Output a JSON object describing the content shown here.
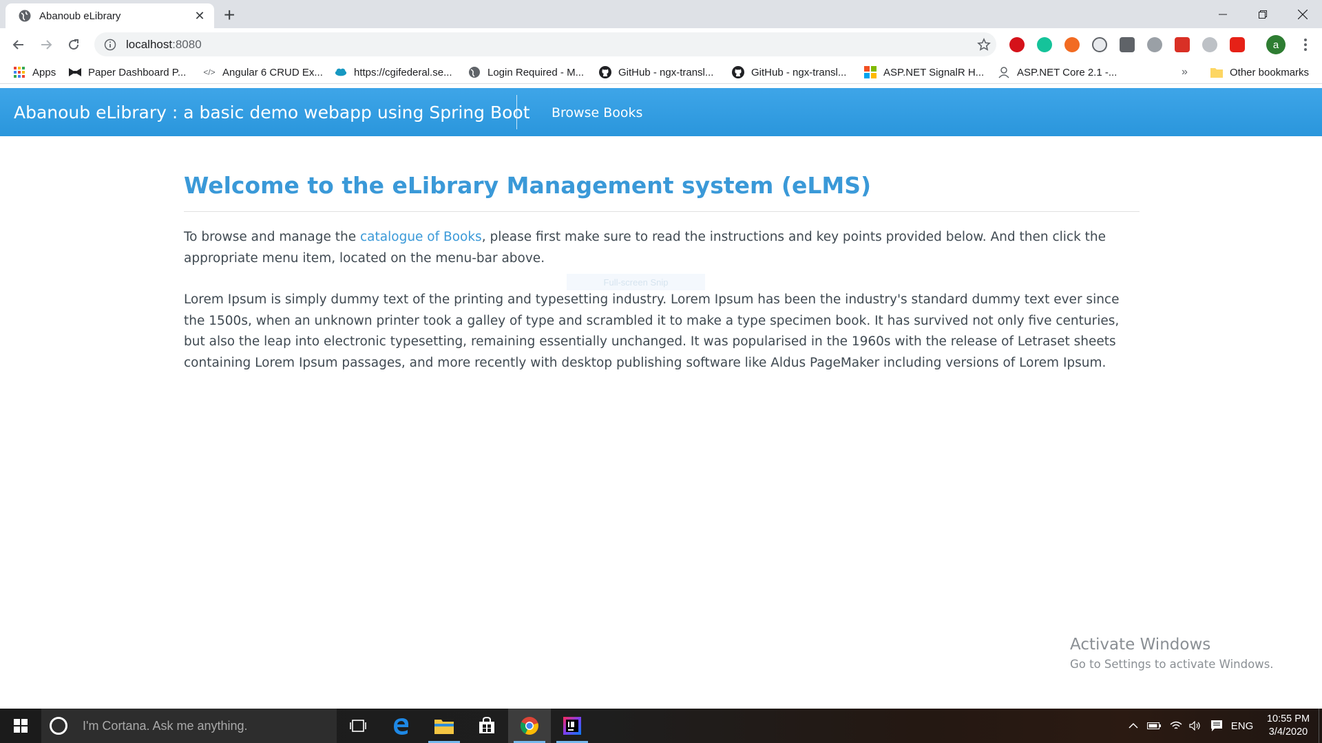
{
  "browser": {
    "tab_title": "Abanoub eLibrary",
    "new_tab": "+",
    "url_host": "localhost",
    "url_port": ":8080",
    "extension_icons": [
      "music-extension-icon",
      "grammarly-icon",
      "extension-orange-icon",
      "dark-mode-icon",
      "angular-devtools-icon",
      "extension-dots-icon",
      "extension-red-icon",
      "extension-cloud-icon",
      "youtube-extension-icon"
    ],
    "profile_initial": "a",
    "bookmarks": [
      {
        "label": "Apps",
        "icon": "apps-grid-icon"
      },
      {
        "label": "Paper Dashboard P...",
        "icon": "bowtie-icon"
      },
      {
        "label": "Angular 6 CRUD Ex...",
        "icon": "code-icon"
      },
      {
        "label": "https://cgifederal.se...",
        "icon": "salesforce-cloud-icon"
      },
      {
        "label": "Login Required - M...",
        "icon": "globe-icon"
      },
      {
        "label": "GitHub - ngx-transl...",
        "icon": "github-icon"
      },
      {
        "label": "GitHub - ngx-transl...",
        "icon": "github-icon"
      },
      {
        "label": "ASP.NET SignalR H...",
        "icon": "microsoft-icon"
      },
      {
        "label": "ASP.NET Core 2.1 -...",
        "icon": "avatar-icon"
      }
    ],
    "bookmarks_overflow": "»",
    "other_bookmarks": "Other bookmarks"
  },
  "app": {
    "brand": "Abanoub eLibrary : a basic demo webapp using Spring Boot",
    "nav_browse": "Browse Books"
  },
  "main": {
    "heading": "Welcome to the eLibrary Management system (eLMS)",
    "intro_before_link": "To browse and manage the ",
    "intro_link": "catalogue of Books",
    "intro_after_link": ", please first make sure to read the instructions and key points provided below. And then click the appropriate menu item, located on the menu-bar above.",
    "lorem": "Lorem Ipsum is simply dummy text of the printing and typesetting industry. Lorem Ipsum has been the industry's standard dummy text ever since the 1500s, when an unknown printer took a galley of type and scrambled it to make a type specimen book. It has survived not only five centuries, but also the leap into electronic typesetting, remaining essentially unchanged. It was popularised in the 1960s with the release of Letraset sheets containing Lorem Ipsum passages, and more recently with desktop publishing software like Aldus PageMaker including versions of Lorem Ipsum."
  },
  "overlay": {
    "snip_label": "Full-screen Snip"
  },
  "watermark": {
    "line1": "Activate Windows",
    "line2": "Go to Settings to activate Windows."
  },
  "taskbar": {
    "cortana_placeholder": "I'm Cortana. Ask me anything.",
    "language": "ENG",
    "time": "10:55 PM",
    "date": "3/4/2020"
  },
  "colors": {
    "accent": "#3a99d8",
    "appbar": "#2a96dc",
    "profile": "#2e7d32"
  }
}
